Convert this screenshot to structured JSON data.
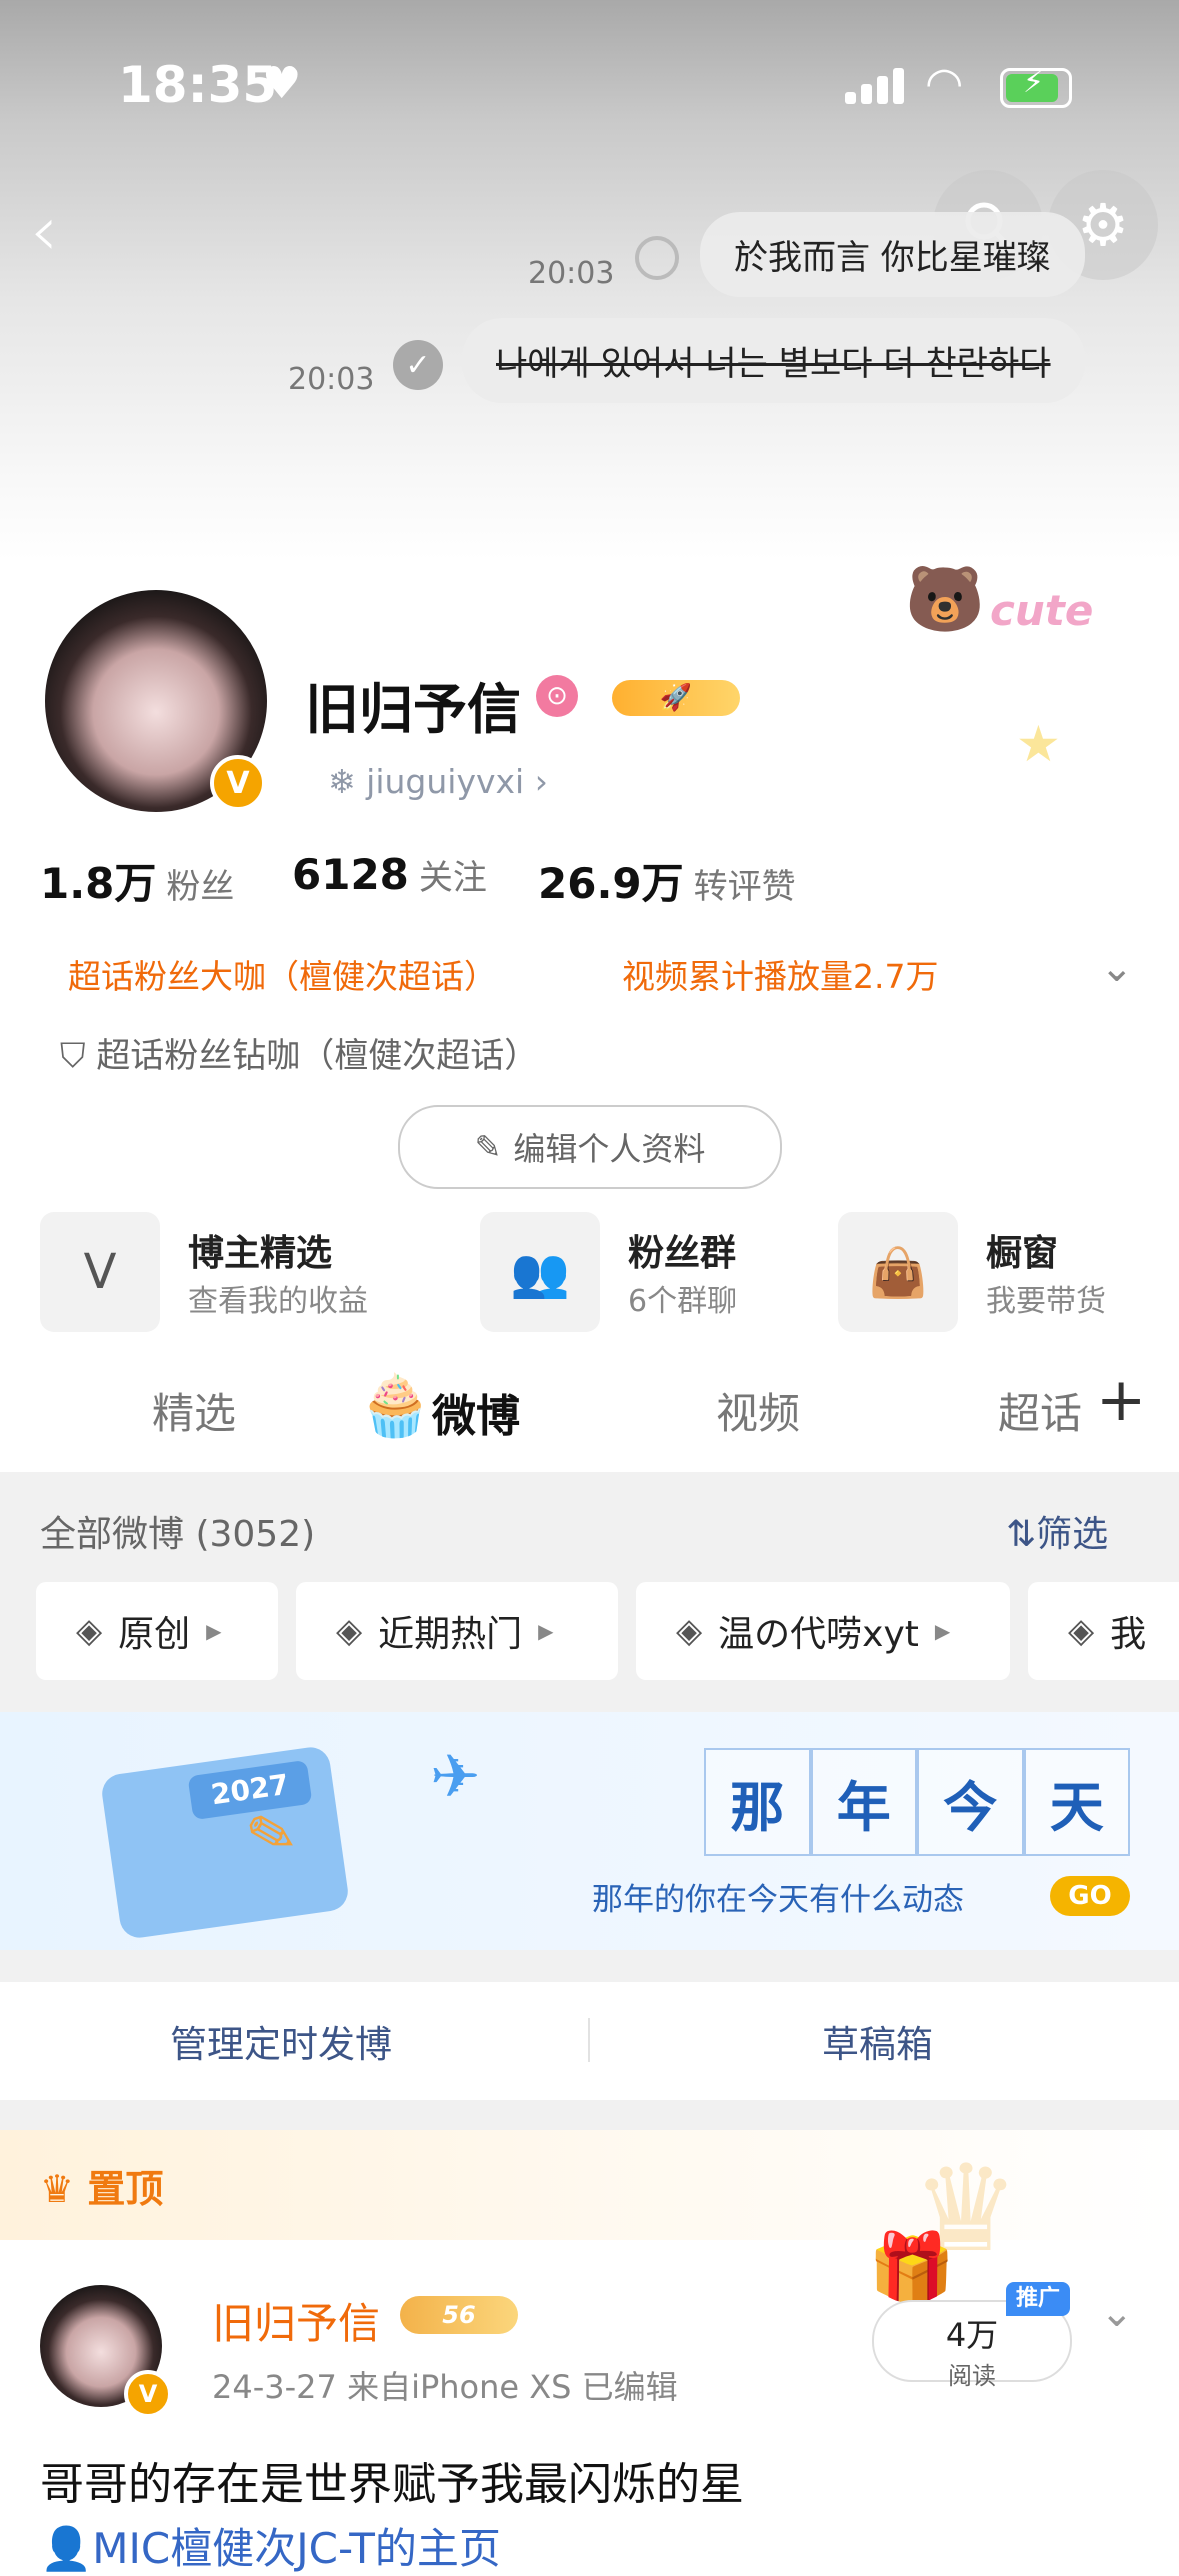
{
  "status_bar": {
    "time": "18:35"
  },
  "chat": {
    "msg1": {
      "time": "20:03",
      "text": "於我而言 你比星璀璨"
    },
    "msg2": {
      "time": "20:03",
      "text": "나에게 있어서 너는 별보다 더 찬란하다"
    }
  },
  "sticker_text": "cute",
  "profile": {
    "name": "旧归予信",
    "handle": "jiuguiyvxi",
    "verified_mark": "V",
    "stats": [
      {
        "value": "1.8万",
        "label": "粉丝"
      },
      {
        "value": "6128",
        "label": "关注"
      },
      {
        "value": "26.9万",
        "label": "转评赞"
      }
    ],
    "tag1": "超话粉丝大咖（檀健次超话）",
    "tag2": "视频累计播放量2.7万",
    "tag3": "超话粉丝钻咖（檀健次超话）",
    "edit_label": "编辑个人资料"
  },
  "features": [
    {
      "title": "博主精选",
      "sub": "查看我的收益"
    },
    {
      "title": "粉丝群",
      "sub": "6个群聊"
    },
    {
      "title": "橱窗",
      "sub": "我要带货"
    }
  ],
  "tabs": [
    "精选",
    "微博",
    "视频",
    "超话"
  ],
  "feed": {
    "all_label": "全部微博 (3052)",
    "filter_label": "筛选",
    "chips": [
      "原创",
      "近期热门",
      "温の代唠xyt",
      "我"
    ]
  },
  "memory": {
    "chars": [
      "那",
      "年",
      "今",
      "天"
    ],
    "subtitle": "那年的你在今天有什么动态",
    "go": "GO",
    "calendar_year": "2027"
  },
  "manage": {
    "scheduled": "管理定时发博",
    "drafts": "草稿箱"
  },
  "post": {
    "pinned_label": "置顶",
    "author": "旧归予信",
    "level": "56",
    "meta": "24-3-27  来自iPhone XS  已编辑",
    "reads_count": "4万",
    "reads_label": "阅读",
    "promo": "推广",
    "text": "哥哥的存在是世界赋予我最闪烁的星",
    "link": "MIC檀健次JC-T的主页"
  },
  "colors": {
    "accent_orange": "#f06a0a",
    "link_blue": "#3567c5",
    "badge_gold": "#f5a400"
  }
}
